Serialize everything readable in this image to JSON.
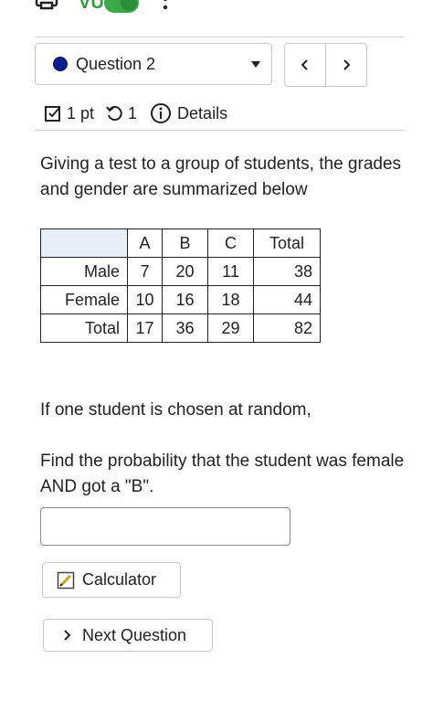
{
  "toolbar": {
    "vu_text": "VU",
    "icons": [
      "printer-icon",
      "toggle-switch",
      "kebab-menu-icon"
    ]
  },
  "question_nav": {
    "selected_question": "Question 2",
    "prev_symbol": "‹",
    "next_symbol": "›"
  },
  "meta": {
    "points": "1 pt",
    "attempts": "1",
    "details_label": "Details"
  },
  "question": {
    "intro": "Giving a test to a group of students, the grades and gender are summarized below",
    "table": {
      "headers": [
        "",
        "A",
        "B",
        "C",
        "Total"
      ],
      "rows": [
        {
          "label": "Male",
          "values": [
            "7",
            "20",
            "11",
            "38"
          ]
        },
        {
          "label": "Female",
          "values": [
            "10",
            "16",
            "18",
            "44"
          ]
        },
        {
          "label": "Total",
          "values": [
            "17",
            "36",
            "29",
            "82"
          ]
        }
      ]
    },
    "condition": "If one student is chosen at random,",
    "ask": "Find the probability that the student was female AND got a \"B\".",
    "answer_value": ""
  },
  "buttons": {
    "calculator": "Calculator",
    "next_question": "Next Question"
  },
  "colors": {
    "accent_green": "#39a845",
    "question_dot": "#0a1f8f",
    "table_header_bg": "#e8eef8"
  }
}
